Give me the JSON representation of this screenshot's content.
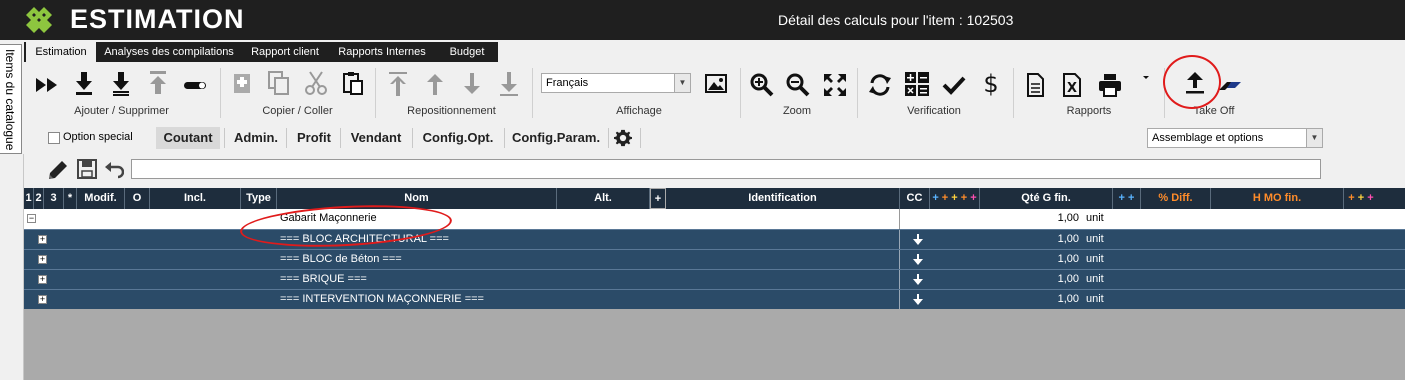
{
  "app": {
    "title": "ESTIMATION",
    "item_detail": "Détail des calculs pour l'item : 102503"
  },
  "side_tab": {
    "label": "Items du catalogue"
  },
  "tabs": [
    {
      "label": "Estimation",
      "active": true
    },
    {
      "label": "Analyses des compilations"
    },
    {
      "label": "Rapport client"
    },
    {
      "label": "Rapports Internes"
    },
    {
      "label": "Budget"
    }
  ],
  "ribbon": {
    "groups": {
      "add_remove": "Ajouter / Supprimer",
      "copy_paste": "Copier / Coller",
      "reposition": "Repositionnement",
      "display": "Affichage",
      "zoom": "Zoom",
      "verification": "Verification",
      "reports": "Rapports",
      "takeoff": "Take Off"
    },
    "language": "Français",
    "icons": {
      "add_remove": [
        "fast-forward-icon",
        "insert-down-icon",
        "insert-bottom-icon",
        "move-top-icon",
        "toggle-icon"
      ],
      "copy_paste": [
        "add-copy-icon",
        "copy-icon",
        "cut-icon",
        "paste-icon"
      ],
      "reposition": [
        "arrow-top-icon",
        "arrow-up-icon",
        "arrow-down-icon",
        "arrow-bottom-icon"
      ],
      "display": [
        "image-icon"
      ],
      "zoom": [
        "zoom-in-icon",
        "zoom-out-icon",
        "fit-screen-icon"
      ],
      "verification": [
        "refresh-icon",
        "calculator-icon",
        "checkmark-icon",
        "dollar-icon"
      ],
      "reports": [
        "document-icon",
        "excel-icon",
        "printer-icon",
        "dropdown-arrow-icon"
      ],
      "takeoff": [
        "upload-icon",
        "takeoff-pen-icon"
      ]
    }
  },
  "viewbar": {
    "option_special": "Option special",
    "views": [
      "Coutant",
      "Admin.",
      "Profit",
      "Vendant",
      "Config.Opt.",
      "Config.Param."
    ],
    "active_view": "Coutant",
    "assembly_select": "Assemblage et options"
  },
  "editbar": {
    "formula_value": ""
  },
  "grid": {
    "columns": {
      "c1": "1",
      "c2": "2",
      "c3": "3",
      "c4": "*",
      "modif": "Modif.",
      "o": "O",
      "incl": "Incl.",
      "type": "Type",
      "nom": "Nom",
      "alt": "Alt.",
      "plus": "+",
      "identification": "Identification",
      "cc": "CC",
      "qte": "Qté G fin.",
      "pct_diff": "% Diff.",
      "hmo": "H MO fin."
    },
    "rows": [
      {
        "nom": "Gabarit Maçonnerie",
        "qty": "1,00",
        "unit": "unit",
        "kind": "header"
      },
      {
        "nom": "=== BLOC ARCHITECTURAL ===",
        "qty": "1,00",
        "unit": "unit",
        "kind": "child"
      },
      {
        "nom": "=== BLOC de Béton ===",
        "qty": "1,00",
        "unit": "unit",
        "kind": "child"
      },
      {
        "nom": "=== BRIQUE ===",
        "qty": "1,00",
        "unit": "unit",
        "kind": "child"
      },
      {
        "nom": "=== INTERVENTION MAÇONNERIE ===",
        "qty": "1,00",
        "unit": "unit",
        "kind": "child"
      }
    ]
  },
  "colors": {
    "accent_green": "#8dc63f",
    "header_bg": "#1e2d3d",
    "row_dark": "#2b4b68",
    "highlight_red": "#e01b1b",
    "orange": "#ff8c2a"
  }
}
